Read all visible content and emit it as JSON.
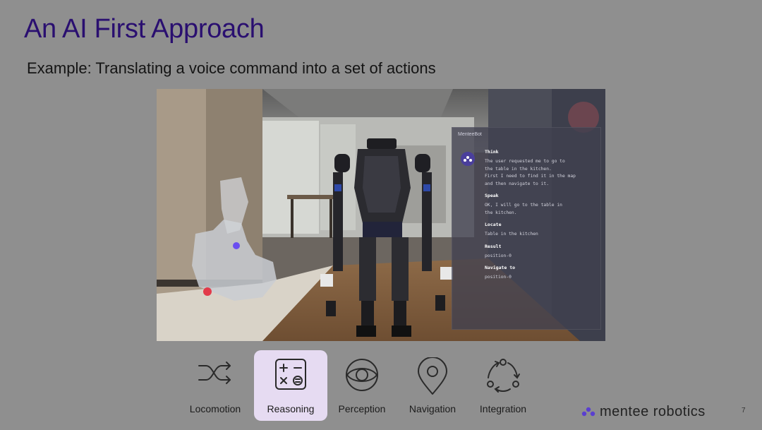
{
  "slide": {
    "title": "An AI First Approach",
    "subtitle": "Example: Translating a voice command into a set of actions",
    "page_number": "7"
  },
  "panel": {
    "app_name": "MenteeBot",
    "sections": [
      {
        "label": "Think",
        "text": "The user requested me to go to\nthe table in the kitchen.\nFirst I need to find it in the map\nand then navigate to it."
      },
      {
        "label": "Speak",
        "text": "OK, I will go to the table in\nthe kitchen."
      },
      {
        "label": "Locate",
        "text": "Table in the kitchen"
      },
      {
        "label": "Result",
        "text": "position-0"
      },
      {
        "label": "Navigate to",
        "text": "position-0"
      }
    ]
  },
  "capabilities": [
    {
      "label": "Locomotion",
      "icon": "shuffle-arrows-icon",
      "active": false
    },
    {
      "label": "Reasoning",
      "icon": "calculator-icon",
      "active": true
    },
    {
      "label": "Perception",
      "icon": "eye-icon",
      "active": false
    },
    {
      "label": "Navigation",
      "icon": "map-pin-icon",
      "active": false
    },
    {
      "label": "Integration",
      "icon": "cycle-arrows-icon",
      "active": false
    }
  ],
  "brand": {
    "name": "mentee robotics"
  },
  "colors": {
    "background": "#8f8f8f",
    "title": "#2a0f70",
    "active_tile": "#e6dbf2",
    "brand_accent": "#5a3fd0"
  }
}
